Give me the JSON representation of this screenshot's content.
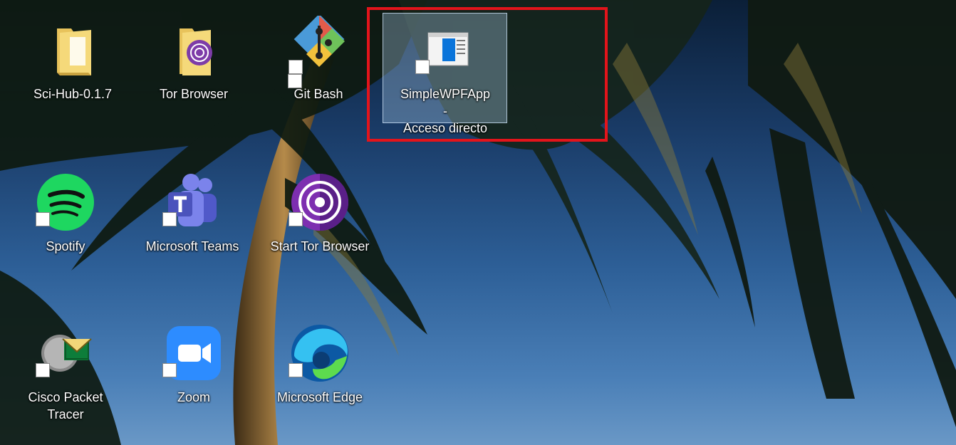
{
  "desktop": {
    "icons": [
      {
        "label": "Sci-Hub-0.1.7",
        "icon": "folder-icon",
        "shortcut": false
      },
      {
        "label": "Tor Browser",
        "icon": "tor-folder-icon",
        "shortcut": false
      },
      {
        "label": "Git Bash",
        "icon": "git-icon",
        "shortcut": true
      },
      {
        "label": "SimpleWPFApp -\nAcceso directo",
        "icon": "wpf-app-icon",
        "shortcut": true,
        "selected": true
      },
      {
        "label": "Spotify",
        "icon": "spotify-icon",
        "shortcut": true
      },
      {
        "label": "Microsoft Teams",
        "icon": "teams-icon",
        "shortcut": true
      },
      {
        "label": "Start Tor Browser",
        "icon": "tor-icon",
        "shortcut": true
      },
      {
        "label": "Cisco Packet Tracer",
        "icon": "packet-tracer-icon",
        "shortcut": true
      },
      {
        "label": "Zoom",
        "icon": "zoom-icon",
        "shortcut": true
      },
      {
        "label": "Microsoft Edge",
        "icon": "edge-icon",
        "shortcut": true
      }
    ]
  },
  "colors": {
    "highlight_border": "#e3141b",
    "selection_bg": "rgba(173,205,235,0.35)"
  }
}
